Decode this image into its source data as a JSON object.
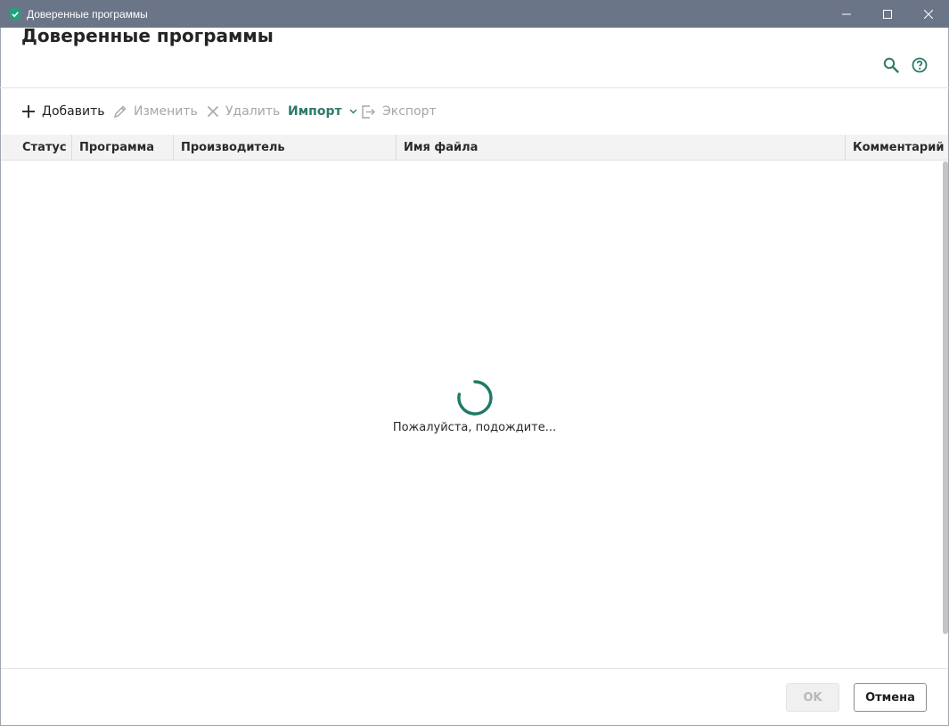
{
  "window": {
    "title": "Доверенные программы"
  },
  "header": {
    "title": "Доверенные программы"
  },
  "toolbar": {
    "add_label": "Добавить",
    "edit_label": "Изменить",
    "delete_label": "Удалить",
    "import_label": "Импорт",
    "export_label": "Экспорт"
  },
  "table": {
    "columns": [
      "Статус",
      "Программа",
      "Производитель",
      "Имя файла",
      "Комментарий"
    ]
  },
  "loading": {
    "text": "Пожалуйста, подождите..."
  },
  "footer": {
    "ok_label": "OK",
    "cancel_label": "Отмена"
  },
  "colors": {
    "titlebar": "#6b7588",
    "accent": "#2d7a68",
    "disabled_text": "#a6a6a6"
  },
  "icons": {
    "app": "shield-check-icon",
    "search": "search-icon",
    "help": "help-icon",
    "add": "plus-icon",
    "edit": "pencil-icon",
    "delete": "close-icon",
    "import_dropdown": "chevron-down-icon",
    "export": "export-icon",
    "minimize": "minimize-icon",
    "maximize": "maximize-icon",
    "close": "close-window-icon"
  }
}
